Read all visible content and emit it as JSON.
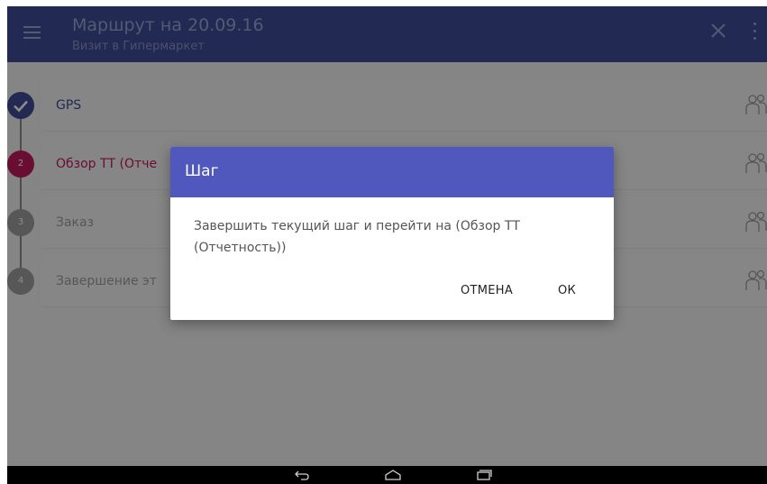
{
  "header": {
    "title": "Маршрут на 20.09.16",
    "subtitle": "Визит в Гипермаркет",
    "menu_icon": "menu-icon",
    "close_icon": "close-icon",
    "more_icon": "more-vertical-icon"
  },
  "steps": [
    {
      "label": "GPS",
      "marker": "",
      "state": "done",
      "color": "#3f4b96"
    },
    {
      "label": "Обзор ТТ (Отче",
      "marker": "2",
      "state": "current",
      "color": "#c2185b"
    },
    {
      "label": "Заказ",
      "marker": "3",
      "state": "pending",
      "color": "#9e9e9e"
    },
    {
      "label": "Завершение эт",
      "marker": "4",
      "state": "pending",
      "color": "#9e9e9e"
    }
  ],
  "dialog": {
    "title": "Шаг",
    "message": "Завершить текущий шаг и перейти на (Обзор ТТ (Отчетность))",
    "cancel_label": "ОТМЕНА",
    "ok_label": "ОК"
  },
  "navbar": {
    "icons": [
      "back-icon",
      "home-icon",
      "recent-apps-icon"
    ]
  },
  "colors": {
    "appbar": "#3f4b96",
    "dialog_header": "#5158bd",
    "current_step": "#c2185b"
  }
}
